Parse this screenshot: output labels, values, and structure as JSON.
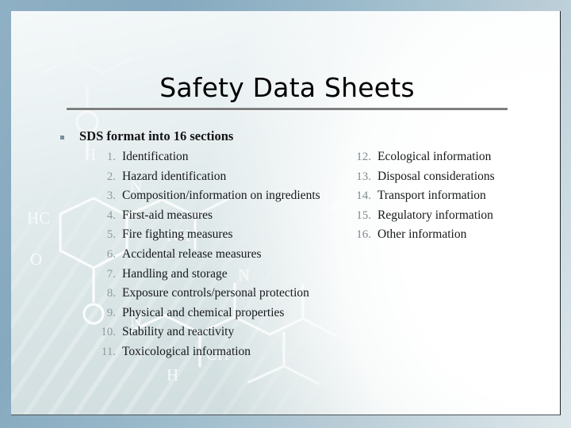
{
  "slide": {
    "title": "Safety Data Sheets",
    "heading": "SDS format into 16 sections",
    "bullet_glyph": "square-bullet",
    "accent_colors": {
      "title_rule": "#7f7f7f",
      "bullet": "#7a8f9c",
      "frame_blue": "#86a9bf",
      "canvas_pale": "#d2dedf",
      "body_text": "#16181a",
      "number_text": "#8f9a9d"
    },
    "background": {
      "watermark": "molecular-structure-watermark",
      "hatch": "diagonal-streak-overlay"
    },
    "sections_left": [
      {
        "number": "1.",
        "label": "Identification"
      },
      {
        "number": "2.",
        "label": "Hazard identification"
      },
      {
        "number": "3.",
        "label": "Composition/information on ingredients"
      },
      {
        "number": "4.",
        "label": "First-aid measures"
      },
      {
        "number": "5.",
        "label": "Fire fighting measures"
      },
      {
        "number": "6.",
        "label": "Accidental release measures"
      },
      {
        "number": "7.",
        "label": "Handling and storage"
      },
      {
        "number": "8.",
        "label": "Exposure controls/personal protection"
      },
      {
        "number": "9.",
        "label": "Physical and chemical properties"
      },
      {
        "number": "10.",
        "label": "Stability and reactivity"
      },
      {
        "number": "11.",
        "label": "Toxicological information"
      }
    ],
    "sections_right": [
      {
        "number": "12.",
        "label": "Ecological information"
      },
      {
        "number": "13.",
        "label": "Disposal considerations"
      },
      {
        "number": "14.",
        "label": "Transport information"
      },
      {
        "number": "15.",
        "label": "Regulatory information"
      },
      {
        "number": "16.",
        "label": "Other information"
      }
    ]
  }
}
